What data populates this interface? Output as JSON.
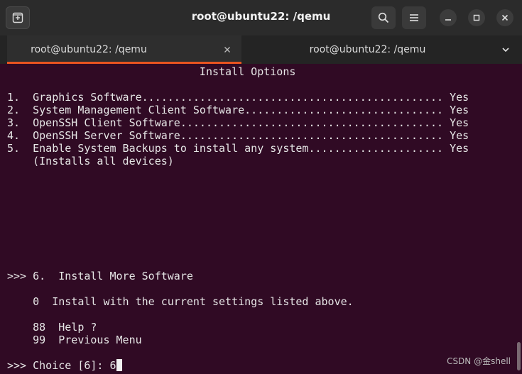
{
  "window": {
    "title": "root@ubuntu22: /qemu"
  },
  "icons": {
    "new_tab": "new-tab-icon",
    "search": "search-icon",
    "menu": "hamburger-menu-icon",
    "minimize": "minimize-icon",
    "maximize": "maximize-icon",
    "close": "close-icon",
    "tab_close": "tab-close-icon",
    "tabs_dropdown": "chevron-down-icon"
  },
  "tabs": [
    {
      "label": "root@ubuntu22: /qemu",
      "active": true
    },
    {
      "label": "root@ubuntu22: /qemu",
      "active": false
    }
  ],
  "colors": {
    "terminal_bg": "#300a24",
    "accent": "#e95420"
  },
  "terminal": {
    "lines": [
      "                              Install Options",
      "",
      "1.  Graphics Software............................................... Yes",
      "2.  System Management Client Software............................... Yes",
      "3.  OpenSSH Client Software......................................... Yes",
      "4.  OpenSSH Server Software......................................... Yes",
      "5.  Enable System Backups to install any system..................... Yes",
      "    (Installs all devices)",
      "",
      "",
      "",
      "",
      "",
      "",
      "",
      ">>> 6.  Install More Software",
      "",
      "    0  Install with the current settings listed above.",
      "",
      "    88  Help ?",
      "    99  Previous Menu",
      "",
      ">>> Choice [6]: 6"
    ]
  },
  "watermark": "CSDN @金shell"
}
